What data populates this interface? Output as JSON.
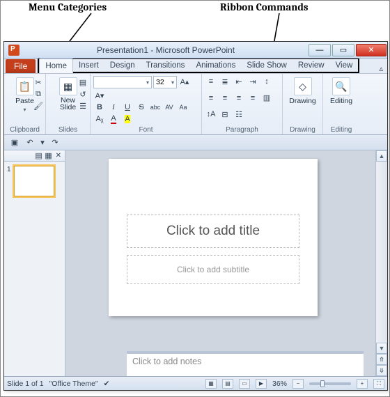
{
  "annotations": {
    "menu_categories": "Menu Categories",
    "ribbon_commands": "Ribbon Commands"
  },
  "window": {
    "title": "Presentation1 - Microsoft PowerPoint",
    "buttons": {
      "min": "—",
      "max": "▭",
      "close": "✕"
    }
  },
  "tabs": {
    "file": "File",
    "items": [
      "Home",
      "Insert",
      "Design",
      "Transitions",
      "Animations",
      "Slide Show",
      "Review",
      "View"
    ],
    "collapse": "▵"
  },
  "ribbon": {
    "clipboard": {
      "paste": "Paste",
      "label": "Clipboard"
    },
    "slides": {
      "new_slide": "New\nSlide",
      "label": "Slides"
    },
    "font": {
      "label": "Font",
      "family": "",
      "size": "32",
      "bold": "B",
      "italic": "I",
      "underline": "U",
      "strike": "S",
      "shadow": "abc",
      "spacing": "AV",
      "case": "Aa",
      "clear": "A"
    },
    "paragraph": {
      "label": "Paragraph"
    },
    "drawing": {
      "btn": "Drawing",
      "label": "Drawing"
    },
    "editing": {
      "btn": "Editing",
      "label": "Editing"
    }
  },
  "qat2": {
    "save": "▣",
    "undo": "↶",
    "redo": "↷",
    "dd": "▾"
  },
  "thumbs": {
    "num": "1"
  },
  "slide": {
    "title_placeholder": "Click to add title",
    "subtitle_placeholder": "Click to add subtitle"
  },
  "notes": {
    "placeholder": "Click to add notes"
  },
  "status": {
    "slide": "Slide 1 of 1",
    "theme": "\"Office Theme\"",
    "zoom": "36%",
    "minus": "−",
    "plus": "+"
  }
}
